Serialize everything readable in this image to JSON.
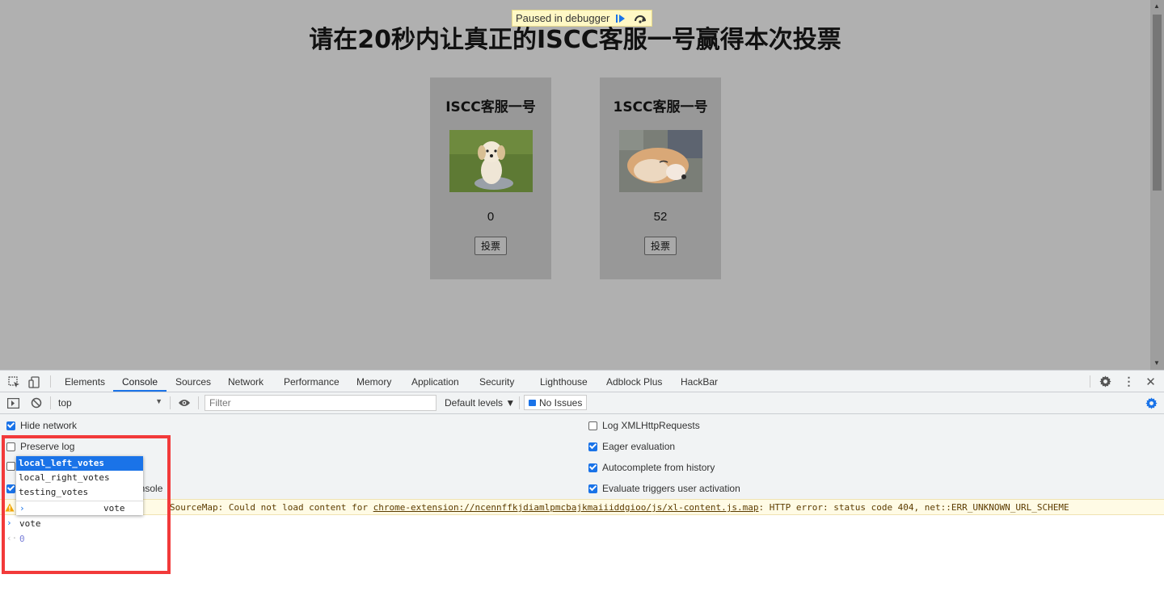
{
  "page": {
    "title": "请在20秒内让真正的ISCC客服一号赢得本次投票",
    "debugger_pill": "Paused in debugger",
    "candidates": [
      {
        "name": "ISCC客服一号",
        "count": "0",
        "vote_label": "投票"
      },
      {
        "name": "1SCC客服一号",
        "count": "52",
        "vote_label": "投票"
      }
    ]
  },
  "devtools": {
    "tabs": [
      {
        "label": "Elements"
      },
      {
        "label": "Console"
      },
      {
        "label": "Sources"
      },
      {
        "label": "Network"
      },
      {
        "label": "Performance"
      },
      {
        "label": "Memory"
      },
      {
        "label": "Application"
      },
      {
        "label": "Security"
      },
      {
        "label": "Lighthouse"
      },
      {
        "label": "Adblock Plus"
      },
      {
        "label": "HackBar"
      }
    ],
    "active_tab": "Console",
    "toolbar": {
      "context": "top",
      "filter_placeholder": "Filter",
      "levels": "Default levels ▼",
      "issues": "No Issues"
    },
    "settings_left": [
      {
        "label": "Hide network",
        "checked": true
      },
      {
        "label": "Preserve log",
        "checked": false
      },
      {
        "label": "",
        "checked": false
      },
      {
        "label": "onsole",
        "checked": true
      }
    ],
    "settings_right": [
      {
        "label": "Log XMLHttpRequests",
        "checked": false
      },
      {
        "label": "Eager evaluation",
        "checked": true
      },
      {
        "label": "Autocomplete from history",
        "checked": true
      },
      {
        "label": "Evaluate triggers user activation",
        "checked": true
      }
    ],
    "warning": {
      "prefix": "SourceMap: Could not load content for ",
      "link": "chrome-extension://ncennffkjdiamlpmcbajkmaiiiddgioo/js/xl-content.js.map",
      "suffix": ": HTTP error: status code 404, net::ERR_UNKNOWN_URL_SCHEME"
    },
    "autocomplete": {
      "items": [
        "local_left_votes",
        "local_right_votes",
        "testing_votes"
      ],
      "input": "vote"
    },
    "console": {
      "input": "vote",
      "result": "0"
    }
  },
  "colors": {
    "accent": "#1a73e8",
    "highlight_box": "#f23a3a",
    "page_bg": "#b0b0b0",
    "card_bg": "#989898"
  }
}
